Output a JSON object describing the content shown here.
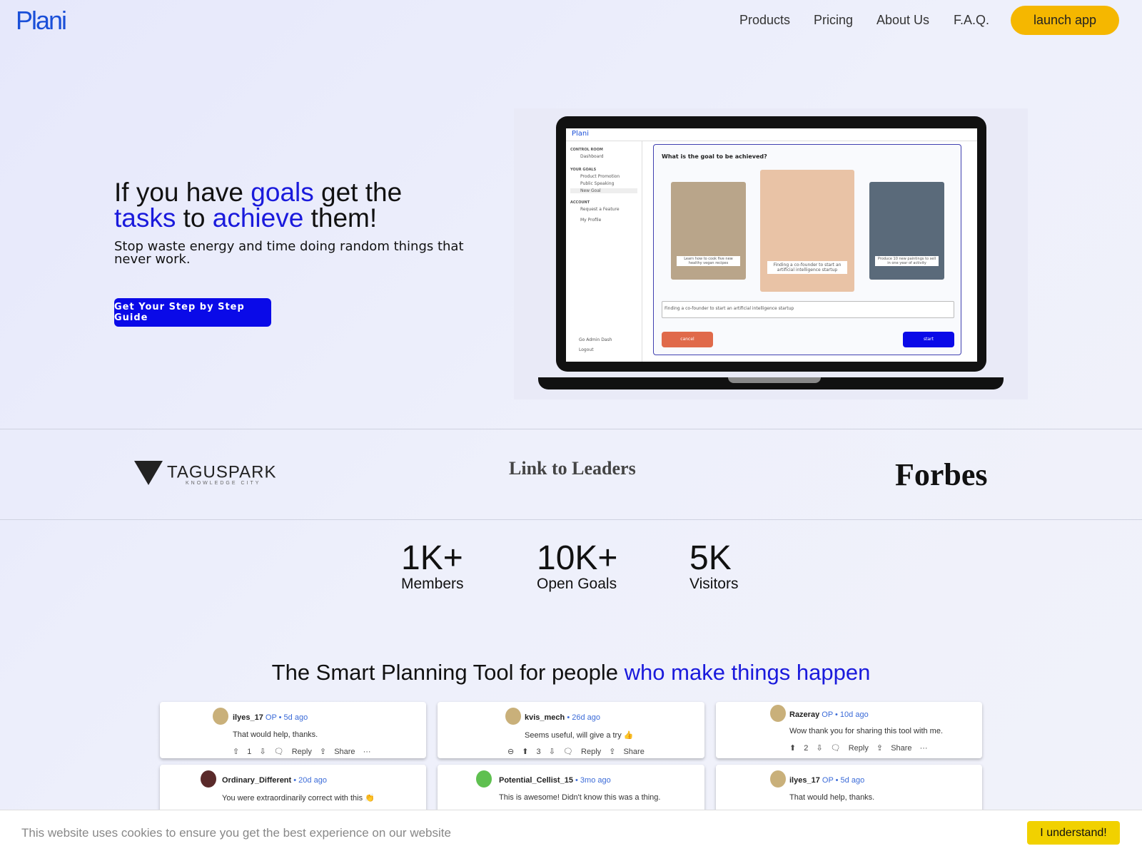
{
  "header": {
    "logo": "Plani",
    "nav": [
      "Products",
      "Pricing",
      "About Us",
      "F.A.Q."
    ],
    "launch": "launch app"
  },
  "hero": {
    "title_parts": [
      "If you have ",
      "goals",
      " get the ",
      "tasks",
      " to ",
      "achieve",
      " them!"
    ],
    "subtitle": "Stop waste energy and time doing random things that never work.",
    "cta": "Get Your Step by Step Guide"
  },
  "app_screenshot": {
    "logo": "Plani",
    "sections": [
      {
        "title": "CONTROL ROOM",
        "items": [
          "Dashboard"
        ]
      },
      {
        "title": "YOUR GOALS",
        "items": [
          "Product Promotion",
          "Public Speaking",
          "New Goal"
        ]
      },
      {
        "title": "ACCOUNT",
        "items": [
          "Request a Feature",
          "My Profile"
        ]
      }
    ],
    "bottom_items": [
      "Go Admin Dash",
      "Logout"
    ],
    "question": "What is the goal to be achieved?",
    "cards": [
      "Learn how to cook five new healthy vegan recipes",
      "Finding a co-founder to start an artificial intelligence startup",
      "Produce 10 new paintings to sell in one year of activity"
    ],
    "input_value": "Finding a co-founder to start an artificial intelligence startup",
    "cancel": "cancel",
    "start": "start"
  },
  "brands": [
    "TAGUSPARK",
    "Link to Leaders",
    "Forbes"
  ],
  "brand_sub": "KNOWLEDGE CITY",
  "stats": [
    {
      "value": "1K+",
      "label": "Members"
    },
    {
      "value": "10K+",
      "label": "Open Goals"
    },
    {
      "value": "5K",
      "label": "Visitors"
    }
  ],
  "section": {
    "title_plain": "The Smart Planning Tool for people ",
    "title_accent": "who make things happen"
  },
  "comments": [
    {
      "user": "ilyes_17",
      "meta": "OP • 5d ago",
      "text": "That would help, thanks.",
      "actions": "⇧ 1 ⇩ 🗨 Reply ⇪ Share ···"
    },
    {
      "user": "kvis_mech",
      "meta": "• 26d ago",
      "text": "Seems useful, will give a try 👍",
      "actions": "⊖ ⬆ 3 ⇩ 🗨 Reply ⇪ Share"
    },
    {
      "user": "Razeray",
      "meta": "OP • 10d ago",
      "text": "Wow thank you for sharing this tool with me.",
      "actions": "⬆ 2 ⇩ 🗨 Reply ⇪ Share ···"
    },
    {
      "user": "Ordinary_Different",
      "meta": "• 20d ago",
      "text": "You were extraordinarily correct with this 👏",
      "actions": ""
    },
    {
      "user": "Potential_Cellist_15",
      "meta": "• 3mo ago",
      "text": "This is awesome! Didn't know this was a thing.",
      "actions": ""
    },
    {
      "user": "ilyes_17",
      "meta": "OP • 5d ago",
      "text": "That would help, thanks.",
      "actions": ""
    }
  ],
  "cookie": {
    "message": "This website uses cookies to ensure you get the best experience on our website",
    "button": "I understand!"
  },
  "colors": {
    "accent": "#1a1adc",
    "launch": "#f5b700",
    "cookie_button": "#f1d100"
  }
}
